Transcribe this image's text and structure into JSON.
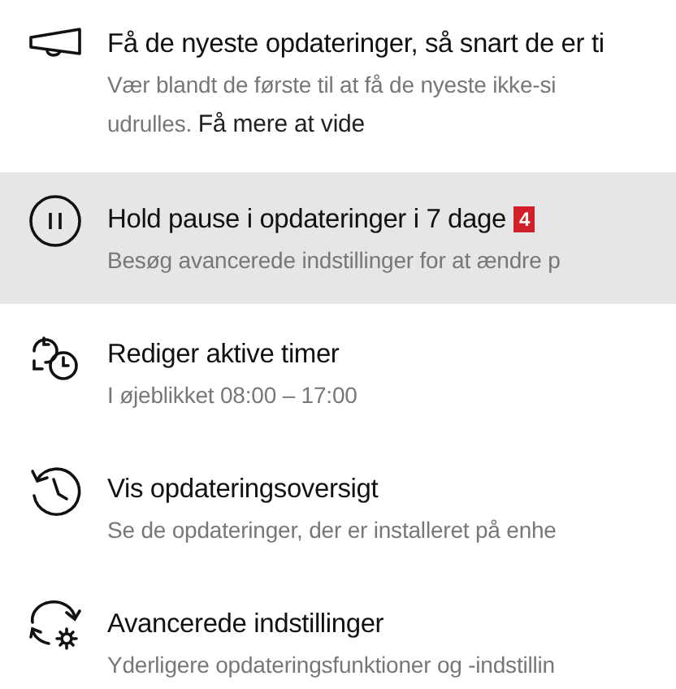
{
  "items": [
    {
      "kind": "megaphone",
      "title": "Få de nyeste opdateringer, så snart de er ti",
      "description_lines": [
        "Vær blandt de første til at få de nyeste ikke-si",
        "udrulles."
      ],
      "link": "Få mere at vide",
      "selected": false
    },
    {
      "kind": "pause",
      "title": "Hold pause i opdateringer i 7 dage",
      "badge": "4",
      "description_lines": [
        "Besøg avancerede indstillinger for at ændre p"
      ],
      "selected": true
    },
    {
      "kind": "clock",
      "title": "Rediger aktive timer",
      "description_lines": [
        "I øjeblikket 08:00 – 17:00"
      ],
      "selected": false
    },
    {
      "kind": "history",
      "title": "Vis opdateringsoversigt",
      "description_lines": [
        "Se de opdateringer, der er installeret på enhe"
      ],
      "selected": false
    },
    {
      "kind": "advanced",
      "title": "Avancerede indstillinger",
      "description_lines": [
        "Yderligere opdateringsfunktioner og -indstillin"
      ],
      "selected": false
    }
  ]
}
